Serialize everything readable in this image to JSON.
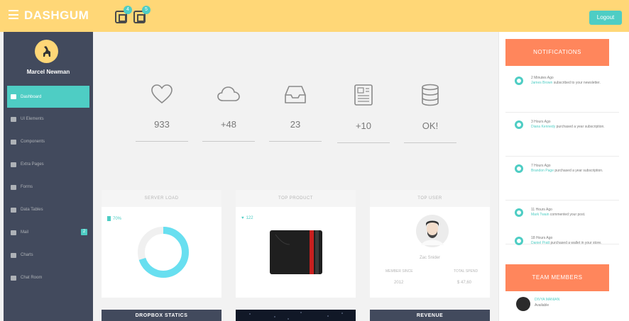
{
  "header": {
    "logo": "DASHGUM",
    "badges": [
      "4",
      "5"
    ],
    "logout": "Logout"
  },
  "sidebar": {
    "user_name": "Marcel Newman",
    "items": [
      {
        "label": "Dashboard",
        "active": true
      },
      {
        "label": "UI Elements"
      },
      {
        "label": "Components"
      },
      {
        "label": "Extra Pages"
      },
      {
        "label": "Forms"
      },
      {
        "label": "Data Tables"
      },
      {
        "label": "Mail",
        "badge": "2"
      },
      {
        "label": "Charts"
      },
      {
        "label": "Chat Room"
      }
    ]
  },
  "stats": [
    {
      "icon": "heart-icon",
      "value": "933"
    },
    {
      "icon": "cloud-icon",
      "value": "+48"
    },
    {
      "icon": "inbox-icon",
      "value": "23"
    },
    {
      "icon": "newspaper-icon",
      "value": "+10"
    },
    {
      "icon": "database-icon",
      "value": "OK!"
    }
  ],
  "panels": {
    "server_load": {
      "title": "SERVER LOAD",
      "stat": "70%",
      "fill_percent": 70
    },
    "top_product": {
      "title": "TOP PRODUCT",
      "stat": "122"
    },
    "top_user": {
      "title": "TOP USER",
      "name": "Zac Snider",
      "member_since_label": "MEMBER SINCE",
      "member_since": "2012",
      "total_spend_label": "TOTAL SPEND",
      "total_spend": "$ 47,60"
    }
  },
  "bottom": {
    "dropbox": "DROPBOX STATICS",
    "revenue": "REVENUE"
  },
  "notifications": {
    "title": "NOTIFICATIONS",
    "items": [
      {
        "time": "2 Minutes Ago",
        "who": "James Brown",
        "text": "subscribed to your newsletter."
      },
      {
        "time": "3 Hours Ago",
        "who": "Diana Kennedy",
        "text": "purchased a year subscription."
      },
      {
        "time": "7 Hours Ago",
        "who": "Brandon Page",
        "text": "purchased a year subscription."
      },
      {
        "time": "11 Hours Ago",
        "who": "Mark Twain",
        "text": "commented your post."
      },
      {
        "time": "18 Hours Ago",
        "who": "Daniel Pratt",
        "text": "purchased a wallet in your store."
      }
    ]
  },
  "team": {
    "title": "TEAM MEMBERS",
    "members": [
      {
        "name": "DIVYA MANIAN",
        "status": "Available"
      }
    ]
  },
  "colors": {
    "header": "#ffd777",
    "accent": "#4ecdc4",
    "sidebar": "#424a5d",
    "orange": "#ff865c"
  }
}
